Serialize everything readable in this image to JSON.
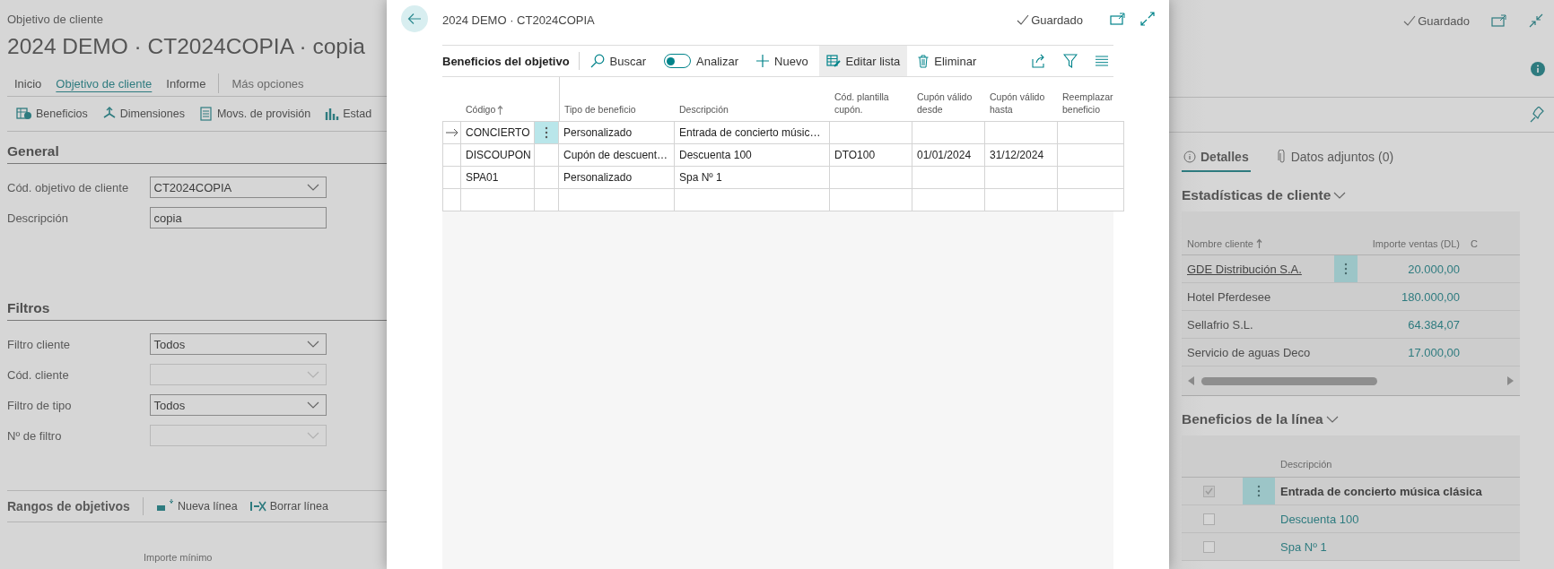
{
  "background_page": {
    "breadcrumb": "Objetivo de cliente",
    "title": "2024 DEMO · CT2024COPIA · copia",
    "tabs": [
      {
        "label": "Inicio",
        "selected": false
      },
      {
        "label": "Objetivo de cliente",
        "selected": true
      },
      {
        "label": "Informe",
        "selected": false
      }
    ],
    "more_options": "Más opciones",
    "actions": [
      {
        "label": "Beneficios",
        "kind": "benefits"
      },
      {
        "label": "Dimensiones",
        "kind": "dimensions"
      },
      {
        "label": "Movs. de provisión",
        "kind": "entries"
      },
      {
        "label": "Estad",
        "kind": "statistics"
      }
    ],
    "sections": [
      {
        "title": "General",
        "fields": [
          {
            "label": "Cód. objetivo de cliente",
            "value": "CT2024COPIA",
            "kind": "dropdown",
            "disabled": false
          },
          {
            "label": "Descripción",
            "value": "copia",
            "kind": "text",
            "disabled": false
          }
        ]
      },
      {
        "title": "Filtros",
        "fields": [
          {
            "label": "Filtro cliente",
            "value": "Todos",
            "kind": "dropdown",
            "disabled": false
          },
          {
            "label": "Cód. cliente",
            "kind": "dropdown",
            "disabled": true
          },
          {
            "label": "Filtro de tipo",
            "value": "Todos",
            "kind": "dropdown",
            "disabled": false
          },
          {
            "label": "Nº de filtro",
            "kind": "dropdown",
            "disabled": true
          }
        ]
      }
    ],
    "ranges": {
      "title": "Rangos de objetivos",
      "actions": [
        {
          "label": "Nueva línea",
          "kind": "new-line"
        },
        {
          "label": "Borrar línea",
          "kind": "delete-line"
        }
      ],
      "column_1": "Importe mínimo"
    }
  },
  "dialog": {
    "title": "2024 DEMO · CT2024COPIA",
    "status": "Guardado",
    "part_title": "Beneficios del objetivo",
    "actions": [
      {
        "label": "Buscar",
        "kind": "search",
        "selected": false
      },
      {
        "label": "Analizar",
        "kind": "toggle",
        "on": false,
        "selected": false
      },
      {
        "label": "Nuevo",
        "kind": "new",
        "selected": false
      },
      {
        "label": "Editar lista",
        "kind": "edit-list",
        "selected": true
      },
      {
        "label": "Eliminar",
        "kind": "delete",
        "selected": false
      }
    ],
    "columns": [
      {
        "label": "Código",
        "sorted": true
      },
      {
        "label": "Tipo de beneficio",
        "sorted": false
      },
      {
        "label": "Descripción",
        "sorted": false
      },
      {
        "label": "Cód. plantilla cupón.",
        "sorted": false
      },
      {
        "label": "Cupón válido desde",
        "sorted": false
      },
      {
        "label": "Cupón válido hasta",
        "sorted": false
      },
      {
        "label": "Reemplazar beneficio",
        "sorted": false
      }
    ],
    "rows": [
      {
        "selected": true,
        "code": "CONCIERTO",
        "type": "Personalizado",
        "description": "Entrada de concierto músic…"
      },
      {
        "selected": false,
        "code": "DISCOUPON",
        "type": "Cupón de descuent…",
        "description": "Descuenta 100",
        "coupon_template": "DTO100",
        "valid_from": "01/01/2024",
        "valid_to": "31/12/2024"
      },
      {
        "selected": false,
        "code": "SPA01",
        "type": "Personalizado",
        "description": "Spa Nº 1"
      }
    ]
  },
  "factbox": {
    "status": "Guardado",
    "tabs": [
      {
        "label": "Detalles",
        "kind": "info",
        "selected": true
      },
      {
        "label": "Datos adjuntos (0)",
        "kind": "attachment",
        "selected": false
      }
    ],
    "customer_stats": {
      "title": "Estadísticas de cliente",
      "columns": [
        {
          "label": "Nombre cliente",
          "sorted": true
        },
        {
          "label": "Importe ventas (DL)",
          "sorted": false
        },
        {
          "label": "C",
          "sorted": false
        }
      ],
      "rows": [
        {
          "name": "GDE Distribución S.A.",
          "amount": "20.000,00",
          "selected": true
        },
        {
          "name": "Hotel Pferdesee",
          "amount": "180.000,00",
          "selected": false
        },
        {
          "name": "Sellafrio S.L.",
          "amount": "64.384,07",
          "selected": false
        },
        {
          "name": "Servicio de aguas Deco",
          "amount": "17.000,00",
          "selected": false
        }
      ]
    },
    "line_benefits": {
      "title": "Beneficios de la línea",
      "column": "Descripción",
      "rows": [
        {
          "description": "Entrada de concierto música clásica",
          "checked": true,
          "selected": true
        },
        {
          "description": "Descuenta 100",
          "checked": false,
          "selected": false
        },
        {
          "description": "Spa Nº 1",
          "checked": false,
          "selected": false
        }
      ]
    }
  }
}
